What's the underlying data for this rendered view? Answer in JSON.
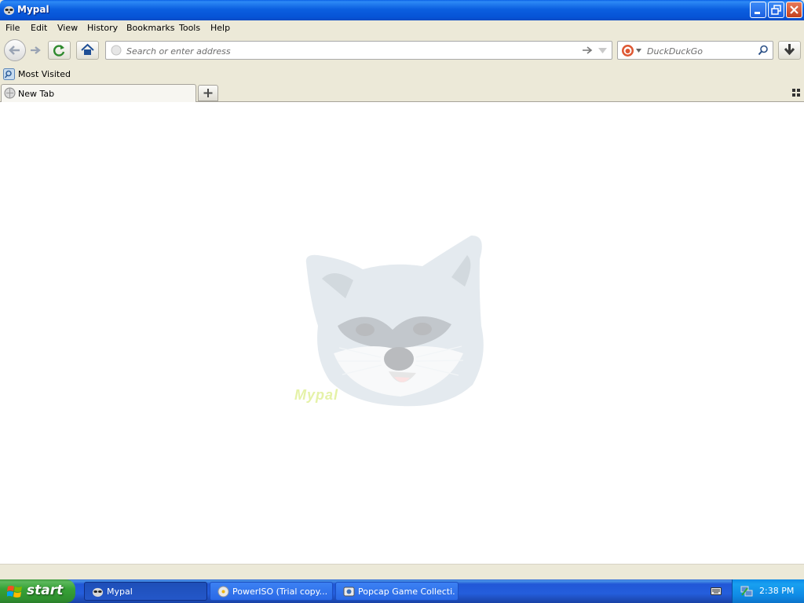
{
  "window": {
    "title": "Mypal"
  },
  "menu": [
    {
      "label": "File"
    },
    {
      "label": "Edit"
    },
    {
      "label": "View"
    },
    {
      "label": "History"
    },
    {
      "label": "Bookmarks"
    },
    {
      "label": "Tools"
    },
    {
      "label": "Help"
    }
  ],
  "urlbar": {
    "placeholder": "Search or enter address",
    "value": ""
  },
  "searchbar": {
    "placeholder": "DuckDuckGo",
    "engine": "DuckDuckGo"
  },
  "bookmarks": [
    {
      "label": "Most Visited"
    }
  ],
  "tabs": [
    {
      "label": "New Tab",
      "active": true
    }
  ],
  "newtab_logo": {
    "text": "Mypal"
  },
  "taskbar": {
    "start_label": "start",
    "tasks": [
      {
        "label": "Mypal",
        "active": true
      },
      {
        "label": "PowerISO (Trial copy..."
      },
      {
        "label": "Popcap Game Collecti..."
      }
    ],
    "clock": "2:38 PM"
  },
  "colors": {
    "titlebar": "#0b5fe0",
    "taskbar": "#245edc",
    "start": "#37a237",
    "tray": "#0f8ae5"
  }
}
